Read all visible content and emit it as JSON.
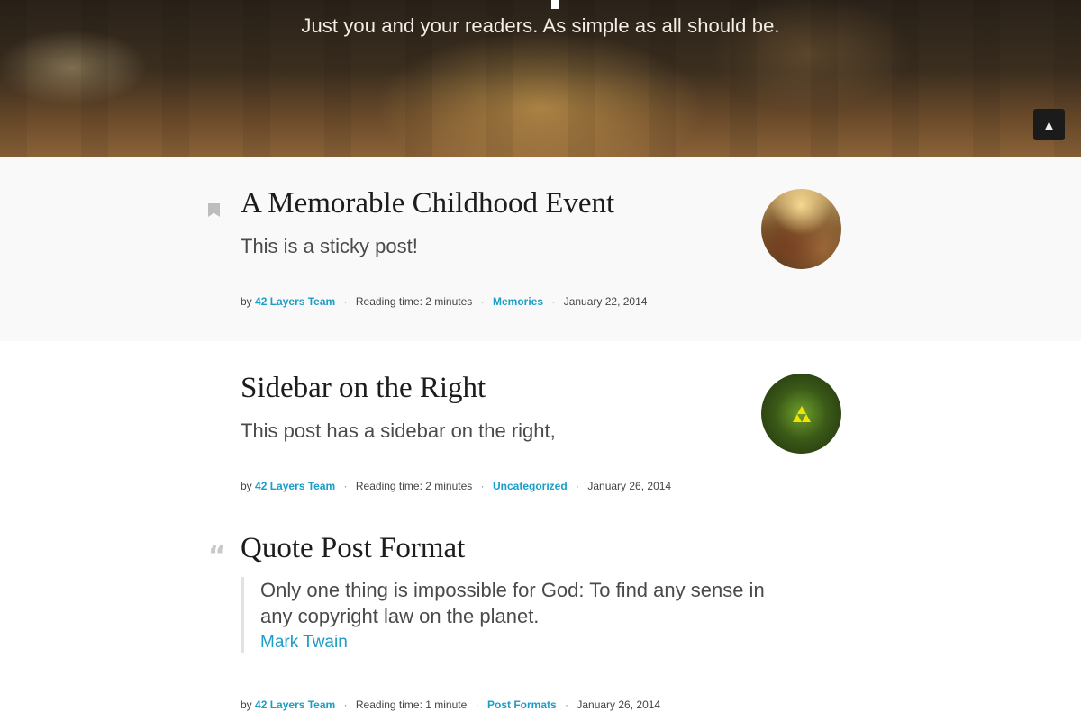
{
  "hero": {
    "tagline": "Just you and your readers. As simple as all should be.",
    "scroll_top_icon": "chevron-up-icon"
  },
  "posts": [
    {
      "title": "A Memorable Childhood Event",
      "excerpt": "This is a sticky post!",
      "format_icon": "bookmark-icon",
      "meta": {
        "by": "by",
        "author": "42 Layers Team",
        "reading_time": "Reading time: 2 minutes",
        "category": "Memories",
        "date": "January 22, 2014"
      }
    },
    {
      "title": "Sidebar on the Right",
      "excerpt": "This post has a sidebar on the right,",
      "meta": {
        "by": "by",
        "author": "42 Layers Team",
        "reading_time": "Reading time: 2 minutes",
        "category": "Uncategorized",
        "date": "January 26, 2014"
      }
    },
    {
      "title": "Quote Post Format",
      "format_icon": "quote-icon",
      "quote": {
        "text": "Only one thing is impossible for God: To find any sense in any copyright law on the planet.",
        "author": "Mark Twain"
      },
      "meta": {
        "by": "by",
        "author": "42 Layers Team",
        "reading_time": "Reading time: 1 minute",
        "category": "Post Formats",
        "date": "January 26, 2014"
      }
    }
  ],
  "colors": {
    "link": "#1a9ec7",
    "sticky_background": "#f9f9f9",
    "scroll_top_background": "#1b1b1b"
  }
}
